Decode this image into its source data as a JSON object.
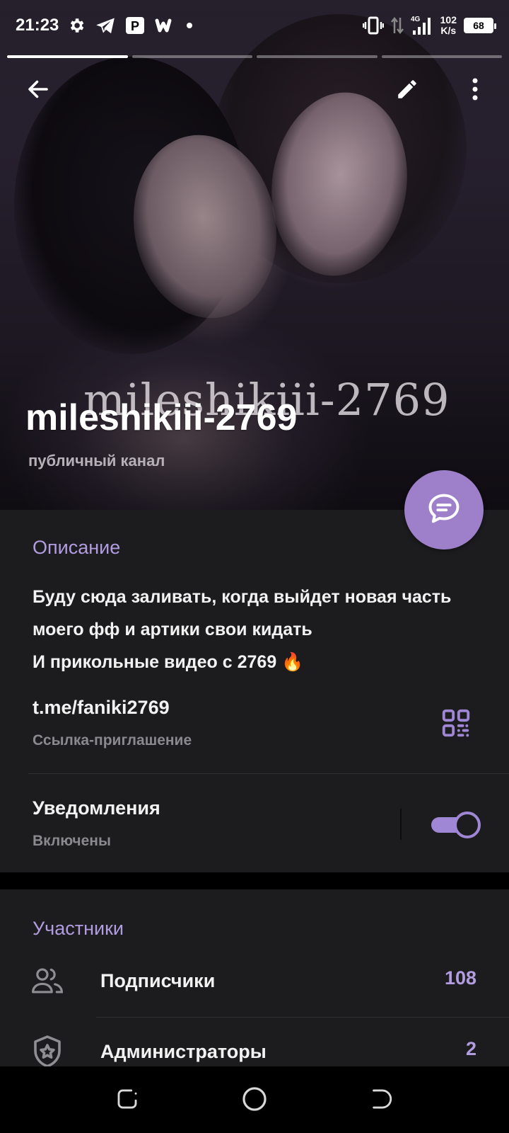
{
  "status_bar": {
    "time": "21:23",
    "network": "4G",
    "speed_value": "102",
    "speed_unit": "K/s",
    "battery": "68",
    "icons": [
      "gear-icon",
      "telegram-icon",
      "parking-icon",
      "wattpad-icon",
      "dot-icon",
      "vibrate-icon",
      "data-arrows-icon",
      "signal-icon"
    ]
  },
  "story_bars": {
    "count": 4,
    "active_index": 0
  },
  "header": {
    "watermark": "mileshikiii-2769",
    "title": "mileshikiii-2769",
    "subtitle": "публичный канал"
  },
  "info": {
    "description_header": "Описание",
    "description_text": "Буду сюда заливать, когда выйдет новая часть моего фф и артики свои кидать\nИ прикольные видео с 2769 🔥",
    "link": "t.me/faniki2769",
    "link_caption": "Ссылка-приглашение",
    "notifications_title": "Уведомления",
    "notifications_status": "Включены",
    "notifications_on": true
  },
  "members": {
    "header": "Участники",
    "rows": [
      {
        "label": "Подписчики",
        "count": "108",
        "icon": "people-icon"
      },
      {
        "label": "Администраторы",
        "count": "2",
        "icon": "shield-star-icon"
      }
    ]
  },
  "colors": {
    "accent": "#9d80c9",
    "accent_text": "#b29ce0",
    "panel": "#1c1c1e",
    "background": "#000000"
  }
}
